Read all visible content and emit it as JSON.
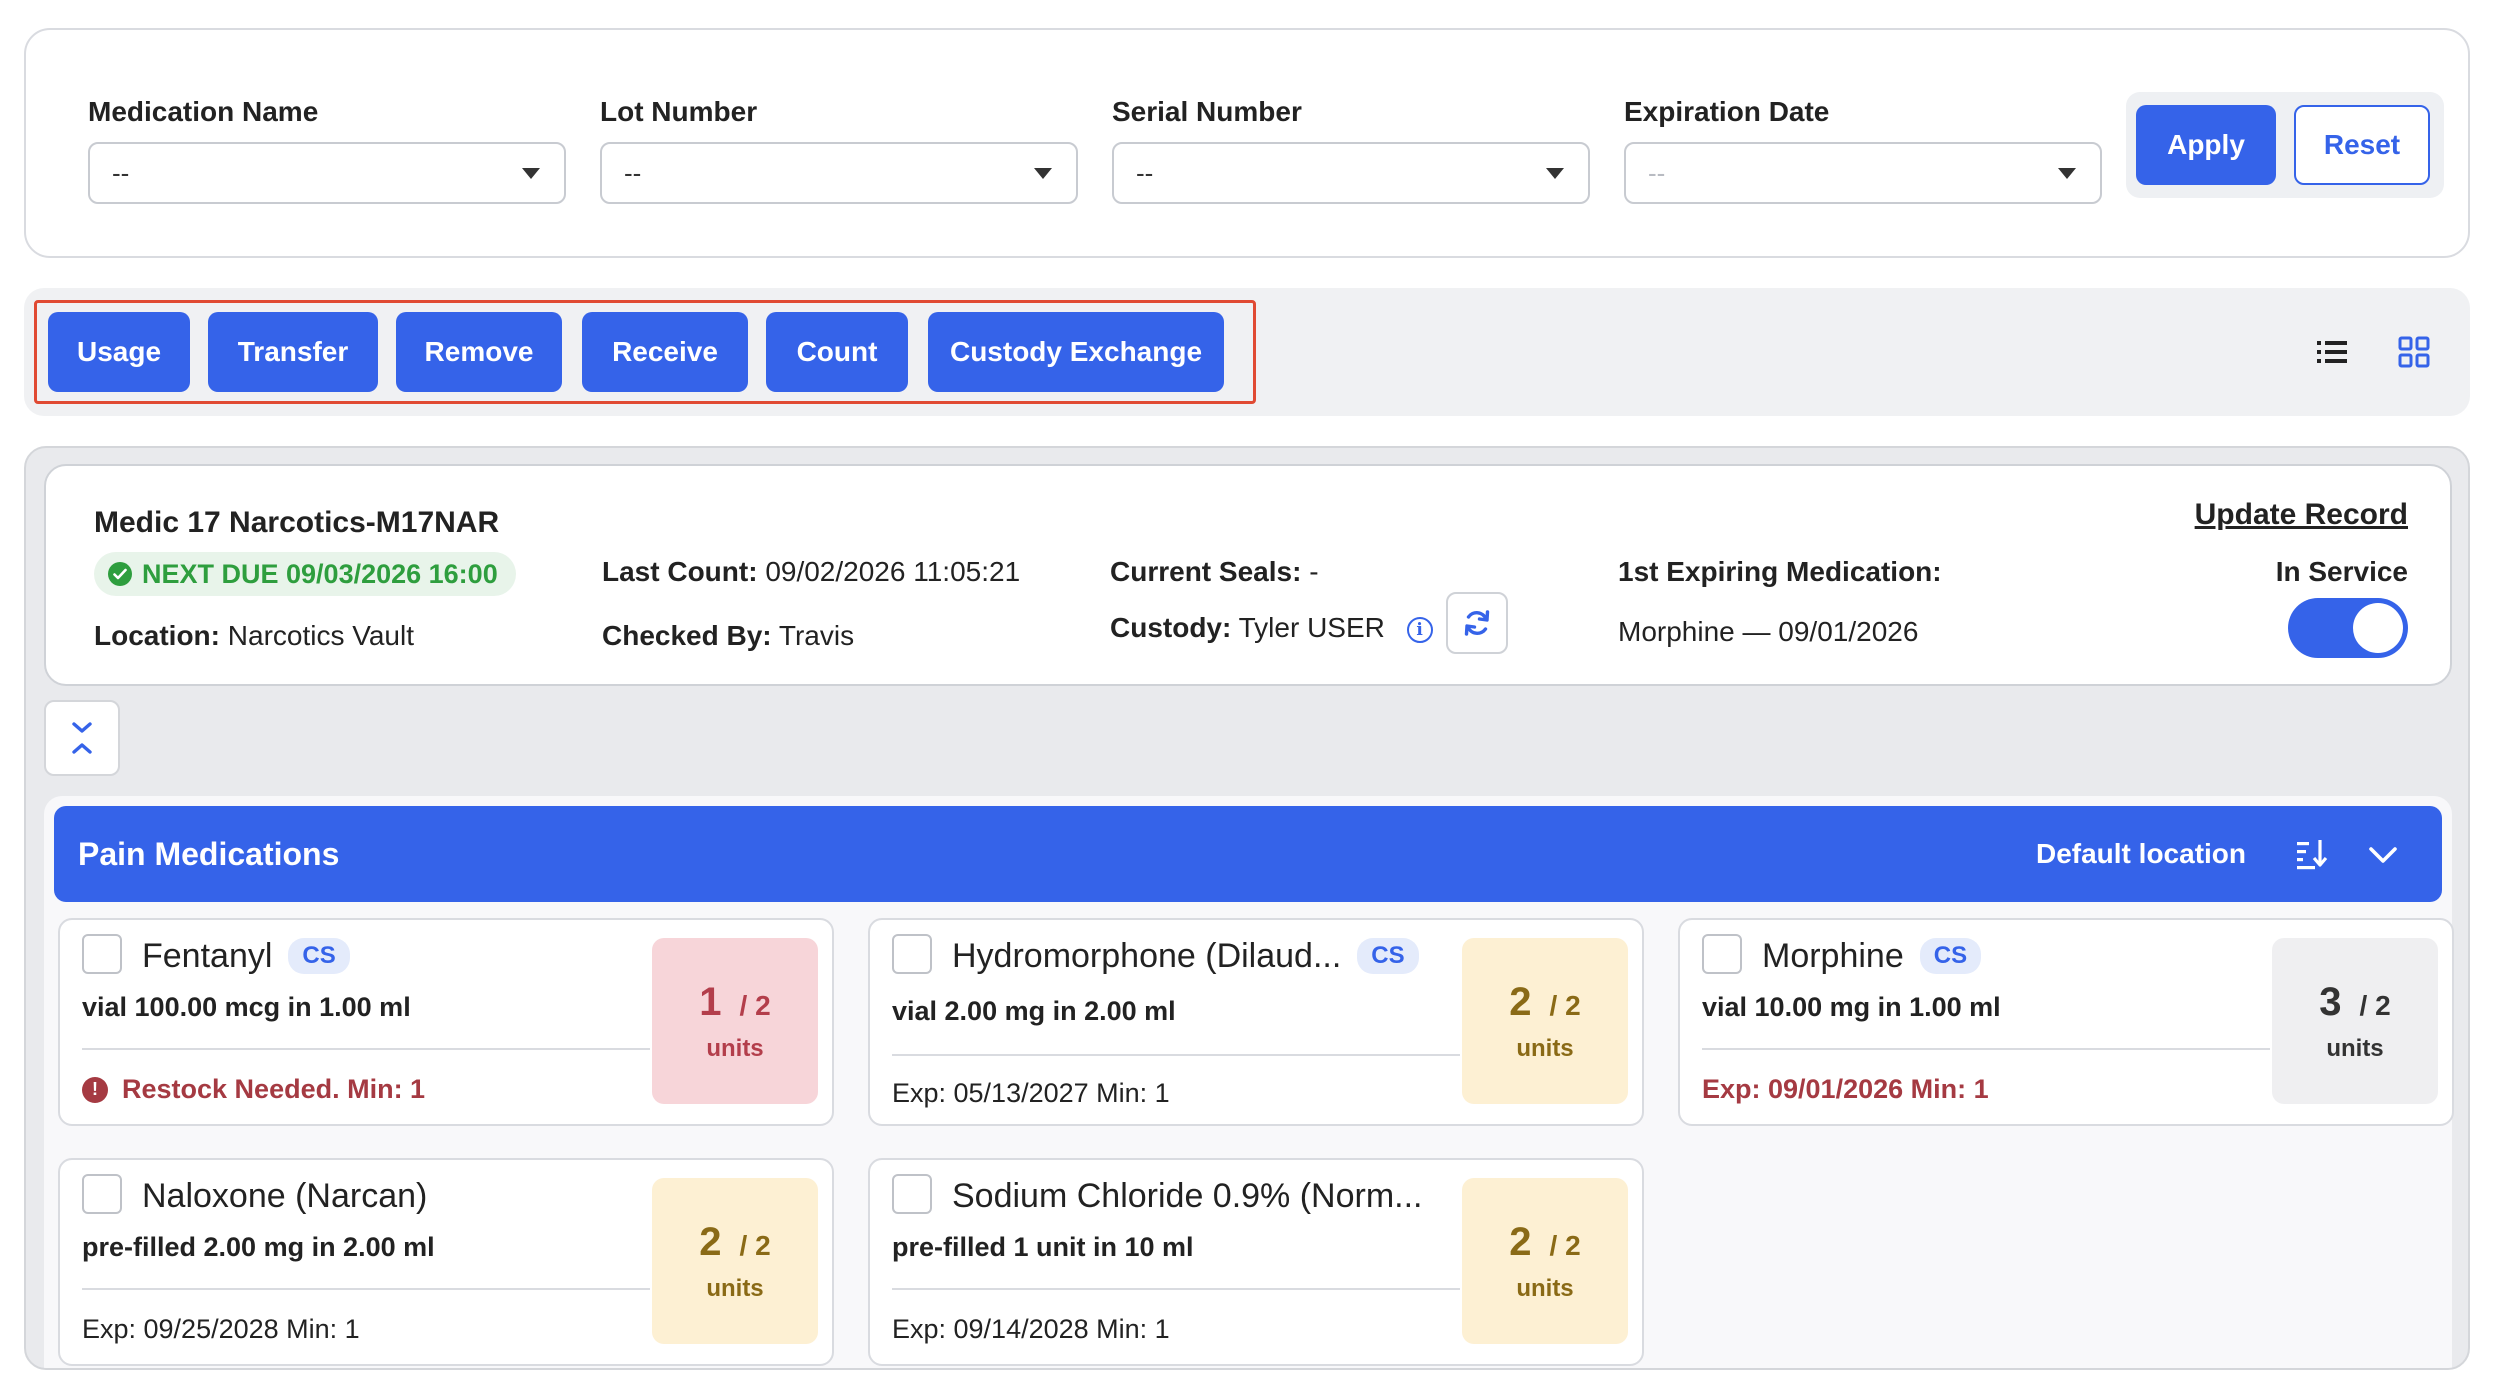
{
  "filters": {
    "fields": [
      {
        "label": "Medication Name",
        "value": "--",
        "disabled": false
      },
      {
        "label": "Lot Number",
        "value": "--",
        "disabled": false
      },
      {
        "label": "Serial Number",
        "value": "--",
        "disabled": false
      },
      {
        "label": "Expiration Date",
        "value": "--",
        "disabled": true
      }
    ],
    "apply_label": "Apply",
    "reset_label": "Reset"
  },
  "actions": [
    "Usage",
    "Transfer",
    "Remove",
    "Receive",
    "Count",
    "Custody Exchange"
  ],
  "view_icons": [
    "list-view-icon",
    "grid-view-icon"
  ],
  "record": {
    "title": "Medic 17 Narcotics-M17NAR",
    "next_due": "NEXT DUE 09/03/2026 16:00",
    "location_label": "Location:",
    "location_value": "Narcotics Vault",
    "last_count_label": "Last Count:",
    "last_count_value": "09/02/2026 11:05:21",
    "checked_by_label": "Checked By:",
    "checked_by_value": "Travis",
    "seals_label": "Current Seals:",
    "seals_value": "-",
    "custody_label": "Custody:",
    "custody_value": "Tyler USER",
    "expiring_label": "1st Expiring Medication:",
    "expiring_value": "Morphine — 09/01/2026",
    "update_label": "Update Record",
    "in_service_label": "In Service",
    "in_service": true
  },
  "group": {
    "title": "Pain Medications",
    "location": "Default location",
    "medications": [
      {
        "name": "Fentanyl",
        "cs": "CS",
        "desc": "vial 100.00 mcg in 1.00 ml",
        "footer": "Restock Needed.  Min: 1",
        "footer_alert": true,
        "qty": "1",
        "total": "/ 2",
        "unit": "units",
        "status": "red"
      },
      {
        "name": "Hydromorphone (Dilaud...",
        "cs": "CS",
        "desc": "vial 2.00 mg in 2.00 ml",
        "footer": "Exp: 05/13/2027  Min: 1",
        "footer_alert": false,
        "qty": "2",
        "total": "/ 2",
        "unit": "units",
        "status": "yellow"
      },
      {
        "name": "Morphine",
        "cs": "CS",
        "desc": "vial 10.00 mg in 1.00 ml",
        "footer": "Exp: 09/01/2026  Min: 1",
        "footer_alert": "text",
        "qty": "3",
        "total": "/ 2",
        "unit": "units",
        "status": "gray"
      },
      {
        "name": "Naloxone (Narcan)",
        "cs": "",
        "desc": "pre-filled 2.00 mg in 2.00 ml",
        "footer": "Exp: 09/25/2028  Min: 1",
        "footer_alert": false,
        "qty": "2",
        "total": "/ 2",
        "unit": "units",
        "status": "yellow"
      },
      {
        "name": "Sodium Chloride 0.9% (Norm...",
        "cs": "",
        "desc": "pre-filled 1 unit in 10 ml",
        "footer": "Exp: 09/14/2028  Min: 1",
        "footer_alert": false,
        "qty": "2",
        "total": "/ 2",
        "unit": "units",
        "status": "yellow"
      }
    ]
  },
  "colors": {
    "primary": "#3563e9",
    "highlight": "#e04a33",
    "success": "#2e9e3e",
    "danger": "#a53a42"
  }
}
